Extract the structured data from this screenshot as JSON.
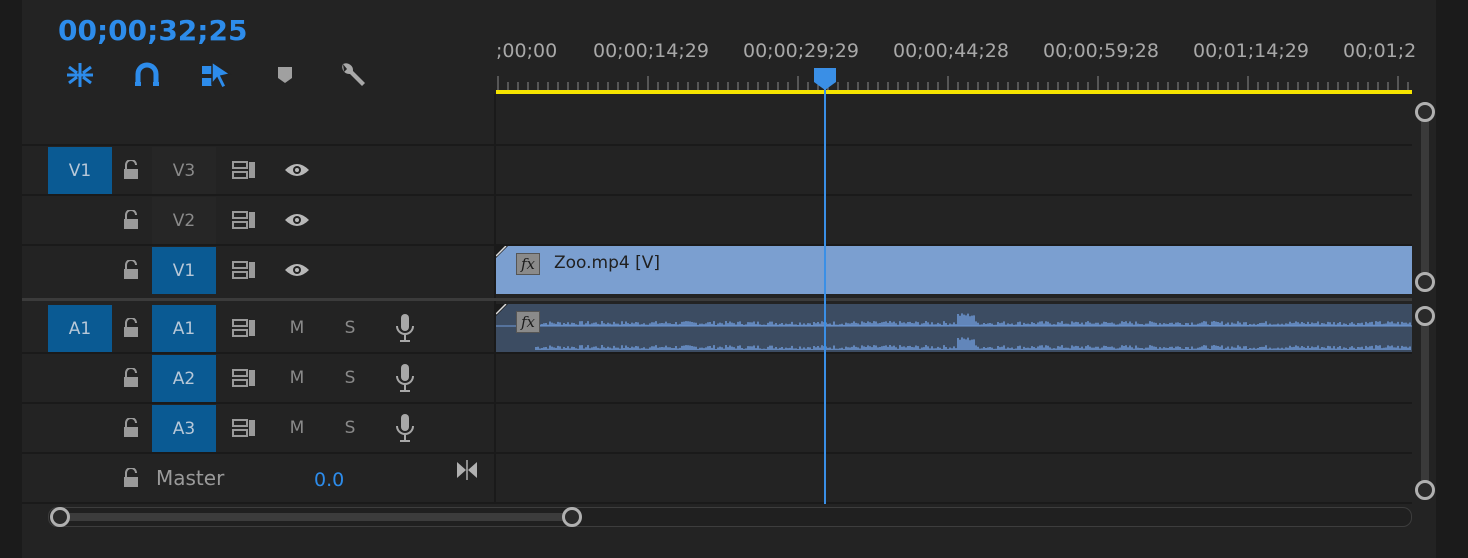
{
  "timecode": "00;00;32;25",
  "toolbar": {
    "icons": [
      "nest-sequences-icon",
      "snap-magnet-icon",
      "linked-selection-icon",
      "add-marker-icon",
      "wrench-settings-icon"
    ],
    "accent": "#2d8ceb"
  },
  "ruler": {
    "labels": [
      ";00;00",
      "00;00;14;29",
      "00;00;29;29",
      "00;00;44;28",
      "00;00;59;28",
      "00;01;14;29",
      "00;01;2"
    ]
  },
  "video_tracks": [
    {
      "source": "V1",
      "name": "V3",
      "targeted": false
    },
    {
      "source": "",
      "name": "V2",
      "targeted": false
    },
    {
      "source": "",
      "name": "V1",
      "targeted": true
    }
  ],
  "audio_tracks": [
    {
      "source": "A1",
      "name": "A1",
      "mute": "M",
      "solo": "S"
    },
    {
      "source": "",
      "name": "A2",
      "mute": "M",
      "solo": "S"
    },
    {
      "source": "",
      "name": "A3",
      "mute": "M",
      "solo": "S"
    }
  ],
  "master": {
    "label": "Master",
    "value": "0.0"
  },
  "clips": {
    "video": {
      "label": "Zoo.mp4 [V]",
      "fx": "fx"
    },
    "audio": {
      "fx": "fx"
    }
  },
  "colors": {
    "video_clip": "#7b9fd0",
    "audio_clip": "#3c4c62",
    "work_area": "#f5e400",
    "track_target": "#0a5a93"
  }
}
